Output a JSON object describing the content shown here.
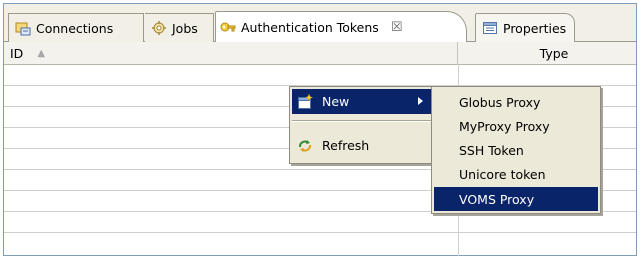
{
  "tabs": [
    {
      "label": "Connections",
      "icon": "connections-icon"
    },
    {
      "label": "Jobs",
      "icon": "jobs-icon"
    },
    {
      "label": "Authentication Tokens",
      "icon": "key-icon",
      "close": "☒"
    },
    {
      "label": "Properties",
      "icon": "properties-icon"
    }
  ],
  "table": {
    "columns": [
      {
        "label": "ID",
        "sort_icon": "▲"
      },
      {
        "label": "Type"
      }
    ],
    "rows": []
  },
  "context_menu": {
    "items": [
      {
        "label": "New",
        "icon": "new-icon",
        "has_submenu": true,
        "selected": true
      },
      {
        "label": "Refresh",
        "icon": "refresh-icon"
      }
    ]
  },
  "submenu": {
    "items": [
      {
        "label": "Globus Proxy"
      },
      {
        "label": "MyProxy Proxy"
      },
      {
        "label": "SSH Token"
      },
      {
        "label": "Unicore token"
      },
      {
        "label": "VOMS Proxy",
        "selected": true
      }
    ]
  },
  "colors": {
    "selection": "#0a246a",
    "menu_bg": "#ece9d8",
    "tabbar_bg": "#f1efe6"
  }
}
